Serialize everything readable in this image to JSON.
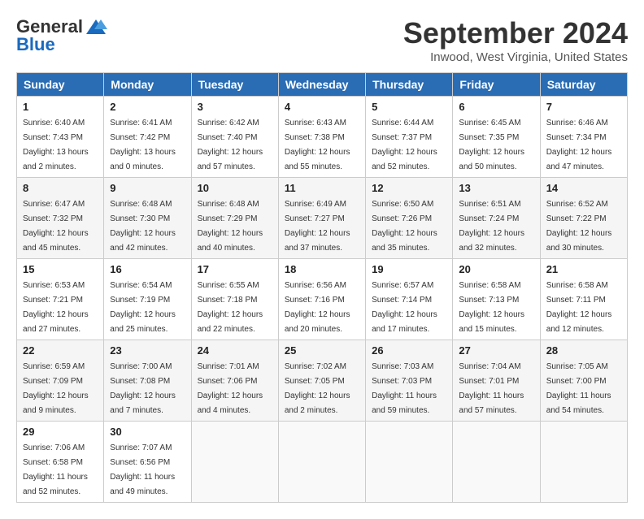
{
  "header": {
    "logo_general": "General",
    "logo_blue": "Blue",
    "month": "September 2024",
    "location": "Inwood, West Virginia, United States"
  },
  "days_of_week": [
    "Sunday",
    "Monday",
    "Tuesday",
    "Wednesday",
    "Thursday",
    "Friday",
    "Saturday"
  ],
  "weeks": [
    [
      {
        "day": "1",
        "sunrise": "6:40 AM",
        "sunset": "7:43 PM",
        "daylight": "13 hours and 2 minutes."
      },
      {
        "day": "2",
        "sunrise": "6:41 AM",
        "sunset": "7:42 PM",
        "daylight": "13 hours and 0 minutes."
      },
      {
        "day": "3",
        "sunrise": "6:42 AM",
        "sunset": "7:40 PM",
        "daylight": "12 hours and 57 minutes."
      },
      {
        "day": "4",
        "sunrise": "6:43 AM",
        "sunset": "7:38 PM",
        "daylight": "12 hours and 55 minutes."
      },
      {
        "day": "5",
        "sunrise": "6:44 AM",
        "sunset": "7:37 PM",
        "daylight": "12 hours and 52 minutes."
      },
      {
        "day": "6",
        "sunrise": "6:45 AM",
        "sunset": "7:35 PM",
        "daylight": "12 hours and 50 minutes."
      },
      {
        "day": "7",
        "sunrise": "6:46 AM",
        "sunset": "7:34 PM",
        "daylight": "12 hours and 47 minutes."
      }
    ],
    [
      {
        "day": "8",
        "sunrise": "6:47 AM",
        "sunset": "7:32 PM",
        "daylight": "12 hours and 45 minutes."
      },
      {
        "day": "9",
        "sunrise": "6:48 AM",
        "sunset": "7:30 PM",
        "daylight": "12 hours and 42 minutes."
      },
      {
        "day": "10",
        "sunrise": "6:48 AM",
        "sunset": "7:29 PM",
        "daylight": "12 hours and 40 minutes."
      },
      {
        "day": "11",
        "sunrise": "6:49 AM",
        "sunset": "7:27 PM",
        "daylight": "12 hours and 37 minutes."
      },
      {
        "day": "12",
        "sunrise": "6:50 AM",
        "sunset": "7:26 PM",
        "daylight": "12 hours and 35 minutes."
      },
      {
        "day": "13",
        "sunrise": "6:51 AM",
        "sunset": "7:24 PM",
        "daylight": "12 hours and 32 minutes."
      },
      {
        "day": "14",
        "sunrise": "6:52 AM",
        "sunset": "7:22 PM",
        "daylight": "12 hours and 30 minutes."
      }
    ],
    [
      {
        "day": "15",
        "sunrise": "6:53 AM",
        "sunset": "7:21 PM",
        "daylight": "12 hours and 27 minutes."
      },
      {
        "day": "16",
        "sunrise": "6:54 AM",
        "sunset": "7:19 PM",
        "daylight": "12 hours and 25 minutes."
      },
      {
        "day": "17",
        "sunrise": "6:55 AM",
        "sunset": "7:18 PM",
        "daylight": "12 hours and 22 minutes."
      },
      {
        "day": "18",
        "sunrise": "6:56 AM",
        "sunset": "7:16 PM",
        "daylight": "12 hours and 20 minutes."
      },
      {
        "day": "19",
        "sunrise": "6:57 AM",
        "sunset": "7:14 PM",
        "daylight": "12 hours and 17 minutes."
      },
      {
        "day": "20",
        "sunrise": "6:58 AM",
        "sunset": "7:13 PM",
        "daylight": "12 hours and 15 minutes."
      },
      {
        "day": "21",
        "sunrise": "6:58 AM",
        "sunset": "7:11 PM",
        "daylight": "12 hours and 12 minutes."
      }
    ],
    [
      {
        "day": "22",
        "sunrise": "6:59 AM",
        "sunset": "7:09 PM",
        "daylight": "12 hours and 9 minutes."
      },
      {
        "day": "23",
        "sunrise": "7:00 AM",
        "sunset": "7:08 PM",
        "daylight": "12 hours and 7 minutes."
      },
      {
        "day": "24",
        "sunrise": "7:01 AM",
        "sunset": "7:06 PM",
        "daylight": "12 hours and 4 minutes."
      },
      {
        "day": "25",
        "sunrise": "7:02 AM",
        "sunset": "7:05 PM",
        "daylight": "12 hours and 2 minutes."
      },
      {
        "day": "26",
        "sunrise": "7:03 AM",
        "sunset": "7:03 PM",
        "daylight": "11 hours and 59 minutes."
      },
      {
        "day": "27",
        "sunrise": "7:04 AM",
        "sunset": "7:01 PM",
        "daylight": "11 hours and 57 minutes."
      },
      {
        "day": "28",
        "sunrise": "7:05 AM",
        "sunset": "7:00 PM",
        "daylight": "11 hours and 54 minutes."
      }
    ],
    [
      {
        "day": "29",
        "sunrise": "7:06 AM",
        "sunset": "6:58 PM",
        "daylight": "11 hours and 52 minutes."
      },
      {
        "day": "30",
        "sunrise": "7:07 AM",
        "sunset": "6:56 PM",
        "daylight": "11 hours and 49 minutes."
      },
      null,
      null,
      null,
      null,
      null
    ]
  ]
}
